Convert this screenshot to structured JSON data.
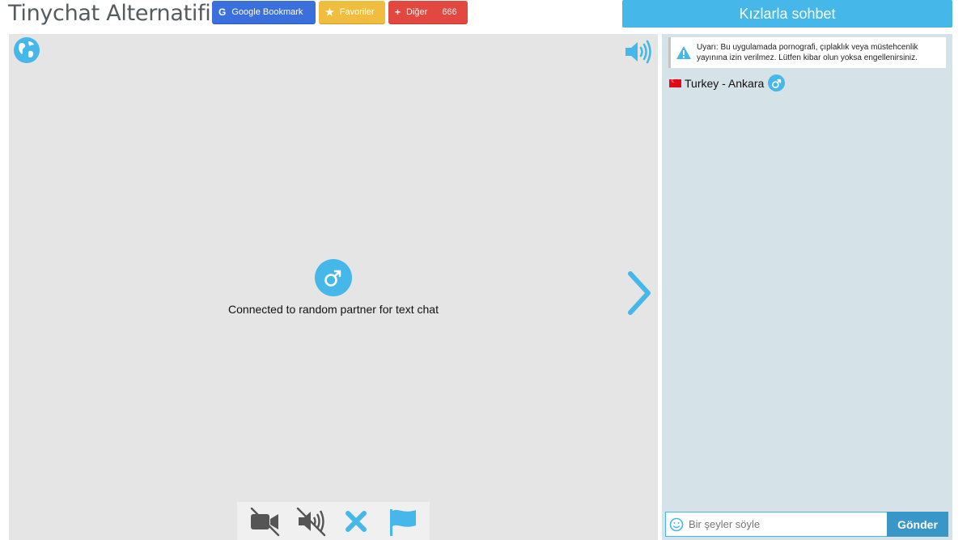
{
  "header": {
    "site_title": "Tinychat Alternatifi",
    "google_bookmark": {
      "icon": "G",
      "label": "Google Bookmark"
    },
    "favorites": {
      "icon": "★",
      "label": "Favoriler"
    },
    "more": {
      "icon": "+",
      "label": "Diğer",
      "count": "666"
    },
    "girls_chat_button": "Kızlarla sohbet"
  },
  "video": {
    "status": "Connected to random partner for text chat",
    "icons": [
      "globe-icon",
      "speaker-icon",
      "male-icon",
      "next-arrow-icon",
      "camera-off-icon",
      "sound-off-icon",
      "close-icon",
      "flag-icon"
    ]
  },
  "chat": {
    "warning": "Uyarı: Bu uygulamada pornografi, çıplaklık veya müstehcenlik yayınına izin verilmez. Lütfen kibar olun yoksa engellenirsiniz.",
    "partner_location": "Turkey - Ankara",
    "input_placeholder": "Bir şeyler söyle",
    "send_label": "Gönder"
  },
  "colors": {
    "accent": "#45b7e8",
    "google": "#3b6fdc",
    "favorites": "#f0bd3e",
    "more": "#e2483f",
    "send": "#3897c6",
    "panel": "#d5e2e8",
    "video_bg": "#e5e5e5"
  }
}
